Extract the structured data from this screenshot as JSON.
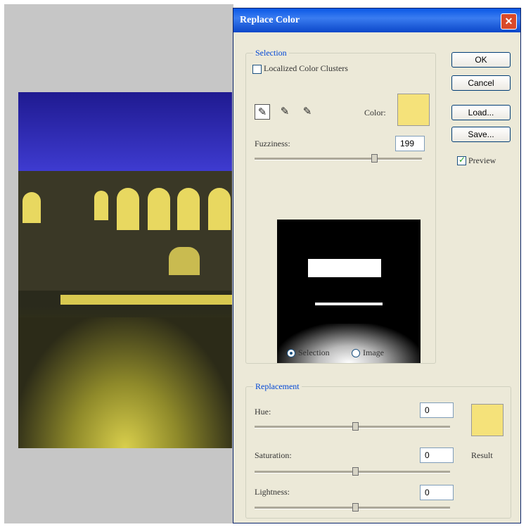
{
  "dialog": {
    "title": "Replace Color",
    "close_glyph": "✕"
  },
  "selection": {
    "legend": "Selection",
    "localized_label": "Localized Color Clusters",
    "color_label": "Color:",
    "fuzziness_label": "Fuzziness:",
    "fuzziness_value": "199",
    "fuzziness_fraction": 0.72,
    "radio_selection": "Selection",
    "radio_image": "Image",
    "selected_color": "#f5e27a"
  },
  "buttons": {
    "ok": "OK",
    "cancel": "Cancel",
    "load": "Load...",
    "save": "Save..."
  },
  "preview": {
    "label": "Preview",
    "checked": true
  },
  "replacement": {
    "legend": "Replacement",
    "hue_label": "Hue:",
    "hue_value": "0",
    "saturation_label": "Saturation:",
    "saturation_value": "0",
    "lightness_label": "Lightness:",
    "lightness_value": "0",
    "result_label": "Result",
    "result_color": "#f5e27a"
  },
  "icons": {
    "eyedropper": "eyedropper-icon",
    "eyedropper_plus": "eyedropper-plus-icon",
    "eyedropper_minus": "eyedropper-minus-icon"
  }
}
